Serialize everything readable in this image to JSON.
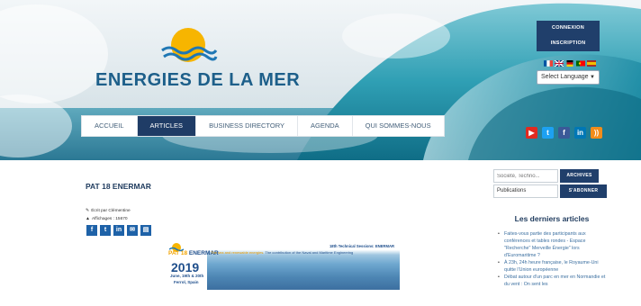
{
  "brand": {
    "logo_text": "ENERGIES DE LA MER"
  },
  "auth": {
    "login": "CONNEXION",
    "signup": "INSCRIPTION"
  },
  "language": {
    "flags": [
      "flag-fr-icon",
      "flag-uk-icon",
      "flag-de-icon",
      "flag-pt-icon",
      "flag-es-icon"
    ],
    "select_value": "Select Language"
  },
  "social": [
    {
      "name": "youtube-icon",
      "glyph": "▶",
      "color": "#e02a20"
    },
    {
      "name": "twitter-icon",
      "glyph": "t",
      "color": "#1da1f2"
    },
    {
      "name": "facebook-icon",
      "glyph": "f",
      "color": "#3b5998"
    },
    {
      "name": "linkedin-icon",
      "glyph": "in",
      "color": "#0077b5"
    },
    {
      "name": "rss-icon",
      "glyph": "))",
      "color": "#f28c1a"
    }
  ],
  "nav": [
    "ACCUEIL",
    "ARTICLES",
    "BUSINESS DIRECTORY",
    "AGENDA",
    "QUI SOMMES-NOUS"
  ],
  "nav_active_index": 1,
  "article": {
    "title": "PAT 18 ENERMAR",
    "author_line": "Écrit par Clémentine",
    "views_line": "Affichages : 15670"
  },
  "share": [
    {
      "name": "share-facebook-icon",
      "glyph": "f"
    },
    {
      "name": "share-twitter-icon",
      "glyph": "t"
    },
    {
      "name": "share-linkedin-icon",
      "glyph": "in"
    },
    {
      "name": "share-email-icon",
      "glyph": "✉"
    },
    {
      "name": "share-print-icon",
      "glyph": "▤"
    }
  ],
  "banner": {
    "brand_main": "ENERMAR",
    "brand_prefix": "PAT 18",
    "year": "2019",
    "dates": "June, 19th & 20th",
    "place": "Ferrol, Spain",
    "session": "18th Technical Sessions: ENERMAR",
    "subtitle_a": "The sea and renewable energies.",
    "subtitle_b": " The contribution of the Naval and Maritime Engineering"
  },
  "sidebar": {
    "search_placeholder": "Société, Techno...",
    "archives_label": "ARCHIVES",
    "newsletter_value": "Publications",
    "subscribe_label": "S'ABONNER",
    "latest_title": "Les derniers articles",
    "latest_items": [
      "Faites-vous partie des participants aux conférences et tables rondes - Espace \"Recherche\" Merveille Énergie\" lors d'Euromaritime ?",
      "À 23h, 24h heure française, le Royaume-Uni quitte l'Union européenne",
      "Débat autour d'un parc en mer en Normandie et du vent : On sent les"
    ]
  },
  "colors": {
    "navy": "#1f3c66",
    "title": "#1f3b5e",
    "link": "#3b6fa0"
  }
}
